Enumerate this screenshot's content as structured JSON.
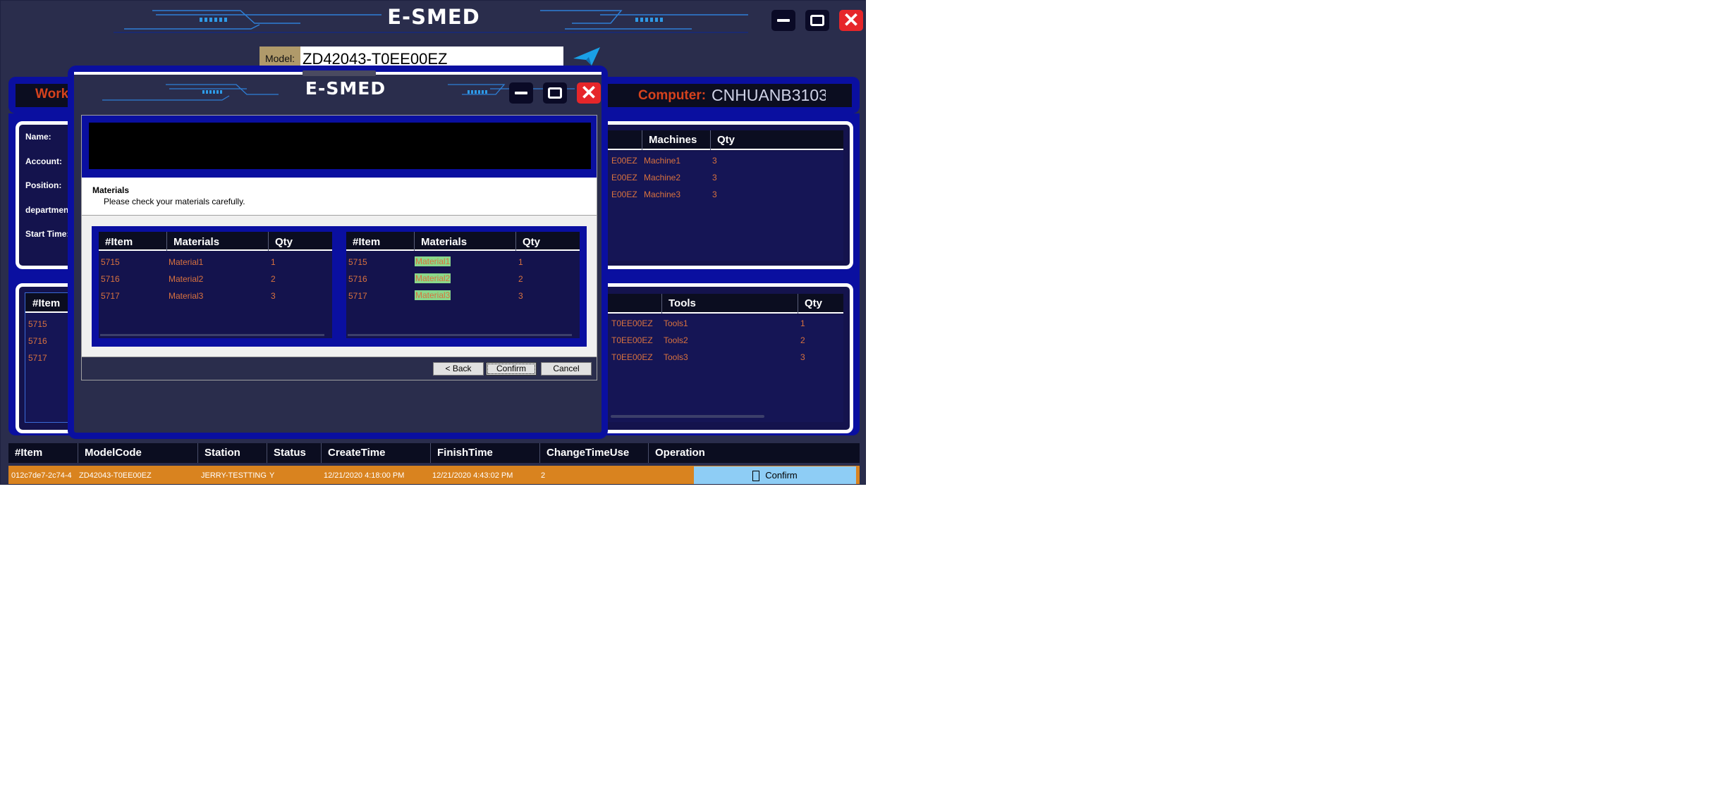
{
  "app": {
    "title": "E-SMED"
  },
  "model": {
    "label": "Model:",
    "value": "ZD42043-T0EE00EZ"
  },
  "info_bar": {
    "work_label": "Work",
    "computer_label": "Computer:",
    "computer_value": "CNHUANB3103"
  },
  "user_info": {
    "fields": [
      "Name:",
      "Account:",
      "Position:",
      "department",
      "Start Time:"
    ]
  },
  "machines_table": {
    "headers": [
      "Machines",
      "Qty"
    ],
    "rows": [
      {
        "model": "E00EZ",
        "name": "Machine1",
        "qty": "3"
      },
      {
        "model": "E00EZ",
        "name": "Machine2",
        "qty": "3"
      },
      {
        "model": "E00EZ",
        "name": "Machine3",
        "qty": "3"
      }
    ]
  },
  "tools_left": {
    "header": "#Item",
    "rows": [
      "5715",
      "5716",
      "5717"
    ]
  },
  "tools_table": {
    "headers": [
      "Tools",
      "Qty"
    ],
    "rows": [
      {
        "model": "T0EE00EZ",
        "name": "Tools1",
        "qty": "1"
      },
      {
        "model": "T0EE00EZ",
        "name": "Tools2",
        "qty": "2"
      },
      {
        "model": "T0EE00EZ",
        "name": "Tools3",
        "qty": "3"
      }
    ]
  },
  "bottom_grid": {
    "headers": [
      "#Item",
      "ModelCode",
      "Station",
      "Status",
      "CreateTime",
      "FinishTime",
      "ChangeTimeUse",
      "Operation"
    ],
    "row": {
      "item": "012c7de7-2c74-4",
      "model_code": "ZD42043-T0EE00EZ",
      "station": "JERRY-TESTTING",
      "status": "Y",
      "create_time": "12/21/2020 4:18:00 PM",
      "finish_time": "12/21/2020 4:43:02 PM",
      "change_time_use": "2",
      "operation_label": "Confirm"
    }
  },
  "dialog": {
    "title": "E-SMED",
    "section_title": "Materials",
    "section_subtitle": "Please check your materials carefully.",
    "left_table": {
      "headers": [
        "#Item",
        "Materials",
        "Qty"
      ],
      "rows": [
        {
          "item": "5715",
          "material": "Material1",
          "qty": "1"
        },
        {
          "item": "5716",
          "material": "Material2",
          "qty": "2"
        },
        {
          "item": "5717",
          "material": "Material3",
          "qty": "3"
        }
      ]
    },
    "right_table": {
      "headers": [
        "#Item",
        "Materials",
        "Qty"
      ],
      "rows": [
        {
          "item": "5715",
          "material": "Material1",
          "qty": "1"
        },
        {
          "item": "5716",
          "material": "Material2",
          "qty": "2"
        },
        {
          "item": "5717",
          "material": "Material3",
          "qty": "3"
        }
      ]
    },
    "buttons": {
      "back": "< Back",
      "confirm": "Confirm",
      "cancel": "Cancel"
    }
  },
  "colors": {
    "accent_blue": "#0a0fa0",
    "orange": "#d9723e",
    "close_red": "#e6262a",
    "row_orange": "#d9831f",
    "confirm_blue": "#8ecdf5"
  }
}
